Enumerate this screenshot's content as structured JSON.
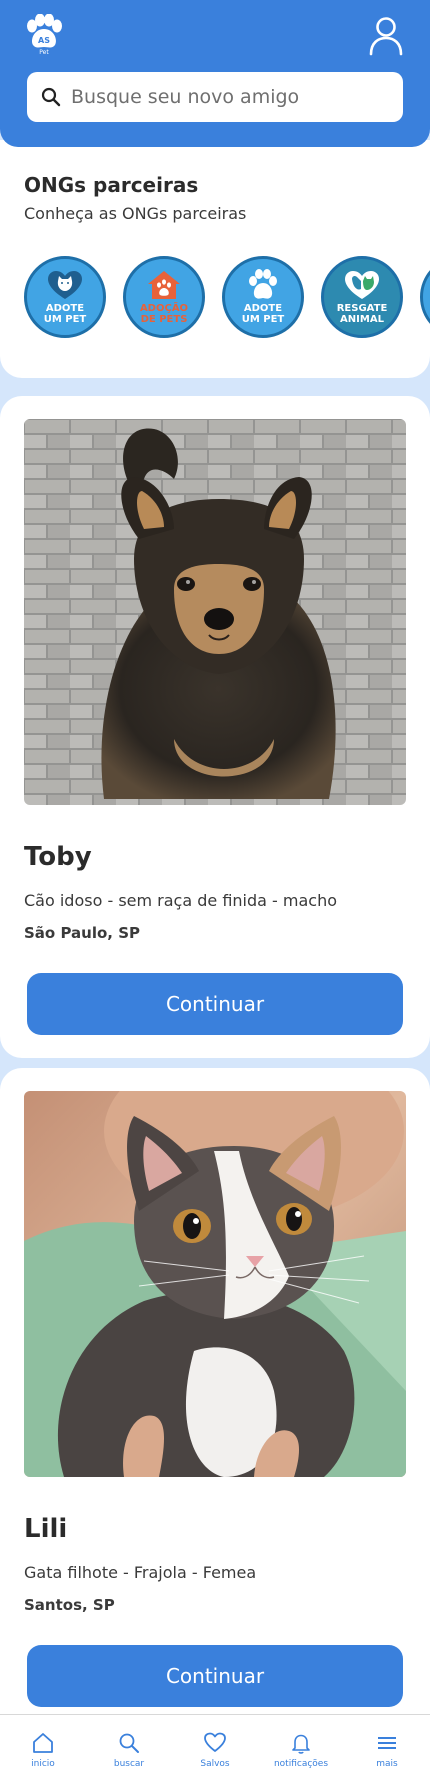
{
  "header": {
    "logo_text": "AS Pet",
    "search": {
      "placeholder": "Busque seu novo amigo",
      "value": ""
    }
  },
  "ongs": {
    "title": "ONGs parceiras",
    "subtitle": "Conheça as ONGs parceiras",
    "items": [
      {
        "label_line1": "ADOTE",
        "label_line2": "UM PET",
        "icon": "cat-heart-icon",
        "bg": "#41a4e4"
      },
      {
        "label_line1": "ADOÇÃO",
        "label_line2": "DE PETS",
        "icon": "house-paw-icon",
        "bg": "#41a4e4"
      },
      {
        "label_line1": "ADOTE",
        "label_line2": "UM PET",
        "icon": "paw-icon",
        "bg": "#41a4e4"
      },
      {
        "label_line1": "RESGATE",
        "label_line2": "ANIMAL",
        "icon": "dog-cat-heart-icon",
        "bg": "#41a4e4"
      }
    ]
  },
  "pets": [
    {
      "name": "Toby",
      "description": "Cão idoso - sem raça de finida - macho",
      "location": "São Paulo, SP",
      "button_label": "Continuar",
      "photo": "dog-photo"
    },
    {
      "name": "Lili",
      "description": "Gata filhote - Frajola - Femea",
      "location": "Santos, SP",
      "button_label": "Continuar",
      "photo": "kitten-photo"
    }
  ],
  "nav": {
    "items": [
      {
        "label": "inicio",
        "icon": "home-icon"
      },
      {
        "label": "buscar",
        "icon": "search-icon"
      },
      {
        "label": "Salvos",
        "icon": "heart-icon"
      },
      {
        "label": "notificações",
        "icon": "bell-icon"
      },
      {
        "label": "mais",
        "icon": "menu-icon"
      }
    ]
  },
  "colors": {
    "primary": "#3a80dc",
    "page_background": "#d5e6fb",
    "card": "#ffffff"
  }
}
